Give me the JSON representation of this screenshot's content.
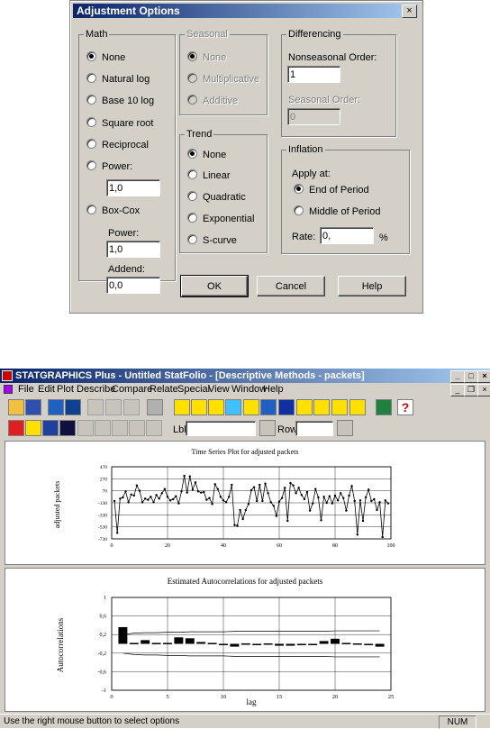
{
  "dialog": {
    "title": "Adjustment Options",
    "close": "×",
    "math": {
      "label": "Math",
      "options": [
        "None",
        "Natural log",
        "Base 10 log",
        "Square root",
        "Reciprocal",
        "Power:"
      ],
      "selected": "None",
      "power_value": "1,0",
      "boxcox_label": "Box-Cox",
      "boxcox_power_label": "Power:",
      "boxcox_power_value": "1,0",
      "addend_label": "Addend:",
      "addend_value": "0,0"
    },
    "seasonal": {
      "label": "Seasonal",
      "options": [
        "None",
        "Multiplicative",
        "Additive"
      ]
    },
    "trend": {
      "label": "Trend",
      "options": [
        "None",
        "Linear",
        "Quadratic",
        "Exponential",
        "S-curve"
      ],
      "selected": "None"
    },
    "differencing": {
      "label": "Differencing",
      "nonseasonal_label": "Nonseasonal Order:",
      "nonseasonal_value": "1",
      "seasonal_label": "Seasonal Order:",
      "seasonal_value": "0"
    },
    "inflation": {
      "label": "Inflation",
      "apply_label": "Apply at:",
      "end_label": "End of Period",
      "middle_label": "Middle of Period",
      "selected": "End of Period",
      "rate_label": "Rate:",
      "rate_value": "0,",
      "rate_unit": "%"
    },
    "buttons": {
      "ok": "OK",
      "cancel": "Cancel",
      "help": "Help"
    }
  },
  "app": {
    "title": "STATGRAPHICS Plus - Untitled StatFolio - [Descriptive Methods - packets]",
    "menu": [
      "File",
      "Edit",
      "Plot",
      "Describe",
      "Compare",
      "Relate",
      "Special",
      "View",
      "Window",
      "Help"
    ],
    "lbl_label": "Lbl",
    "row_label": "Row:",
    "status_text": "Use the right mouse button to select options",
    "status_num": "NUM"
  },
  "chart_data": [
    {
      "type": "line",
      "title": "Time Series Plot for adjusted packets",
      "ylabel": "adjusted packets",
      "xlabel": "",
      "xlim": [
        0,
        100
      ],
      "ylim": [
        -730,
        470
      ],
      "x_ticks": [
        "0",
        "20",
        "40",
        "60",
        "80",
        "100"
      ],
      "y_ticks": [
        "470",
        "270",
        "70",
        "-130",
        "-330",
        "-530",
        "-730"
      ],
      "grid": true,
      "x": [
        1,
        2,
        3,
        4,
        5,
        6,
        7,
        8,
        9,
        10,
        11,
        12,
        13,
        14,
        15,
        16,
        17,
        18,
        19,
        20,
        21,
        22,
        23,
        24,
        25,
        26,
        27,
        28,
        29,
        30,
        31,
        32,
        33,
        34,
        35,
        36,
        37,
        38,
        39,
        40,
        41,
        42,
        43,
        44,
        45,
        46,
        47,
        48,
        49,
        50,
        51,
        52,
        53,
        54,
        55,
        56,
        57,
        58,
        59,
        60,
        61,
        62,
        63,
        64,
        65,
        66,
        67,
        68,
        69,
        70,
        71,
        72,
        73,
        74,
        75,
        76,
        77,
        78,
        79,
        80,
        81,
        82,
        83,
        84,
        85,
        86,
        87,
        88,
        89,
        90,
        91,
        92,
        93,
        94,
        95,
        96,
        97,
        98,
        99
      ],
      "values": [
        -100,
        -630,
        -60,
        -40,
        60,
        -120,
        10,
        -10,
        160,
        70,
        -120,
        -60,
        -80,
        -30,
        -120,
        0,
        -60,
        30,
        100,
        -30,
        -90,
        -70,
        -20,
        -140,
        60,
        320,
        40,
        310,
        90,
        210,
        60,
        40,
        50,
        -80,
        -50,
        -150,
        180,
        100,
        -30,
        -90,
        -120,
        -30,
        170,
        -500,
        -510,
        -250,
        -400,
        -250,
        -150,
        80,
        130,
        -100,
        170,
        -100,
        190,
        30,
        -120,
        -180,
        -350,
        -110,
        -50,
        120,
        -430,
        200,
        160,
        30,
        120,
        0,
        -70,
        50,
        -260,
        -140,
        100,
        -40,
        -420,
        -30,
        -130,
        -20,
        -140,
        -10,
        -90,
        30,
        -50,
        -260,
        -10,
        150,
        -100,
        -660,
        -90,
        -430,
        -40,
        90,
        -100,
        -70,
        -250,
        -120,
        -700,
        -90,
        -140,
        -30,
        -320
      ]
    },
    {
      "type": "bar",
      "title": "Estimated Autocorrelations for adjusted packets",
      "ylabel": "Autocorrelations",
      "xlabel": "lag",
      "xlim": [
        0,
        25
      ],
      "ylim": [
        -1,
        1
      ],
      "x_ticks": [
        "0",
        "5",
        "10",
        "15",
        "20",
        "25"
      ],
      "y_ticks": [
        "1",
        "0,6",
        "0,2",
        "-0,2",
        "-0,6",
        "-1"
      ],
      "grid": true,
      "categories": [
        1,
        2,
        3,
        4,
        5,
        6,
        7,
        8,
        9,
        10,
        11,
        12,
        13,
        14,
        15,
        16,
        17,
        18,
        19,
        20,
        21,
        22,
        23,
        24
      ],
      "values": [
        0.36,
        0.02,
        0.08,
        0.02,
        0.02,
        0.14,
        0.12,
        0.04,
        0.02,
        0.0,
        -0.06,
        0.01,
        0.0,
        0.01,
        -0.04,
        -0.04,
        -0.03,
        -0.02,
        0.06,
        0.11,
        0.02,
        0.01,
        -0.02,
        -0.06
      ],
      "upper_limit": [
        0.2,
        0.23,
        0.24,
        0.24,
        0.25,
        0.25,
        0.26,
        0.26,
        0.26,
        0.26,
        0.27,
        0.27,
        0.27,
        0.27,
        0.27,
        0.27,
        0.27,
        0.27,
        0.27,
        0.28,
        0.28,
        0.28,
        0.28,
        0.28
      ],
      "lower_limit": [
        -0.2,
        -0.23,
        -0.24,
        -0.24,
        -0.25,
        -0.25,
        -0.26,
        -0.26,
        -0.26,
        -0.26,
        -0.27,
        -0.27,
        -0.27,
        -0.27,
        -0.27,
        -0.27,
        -0.27,
        -0.27,
        -0.27,
        -0.28,
        -0.28,
        -0.28,
        -0.28,
        -0.28
      ]
    }
  ]
}
